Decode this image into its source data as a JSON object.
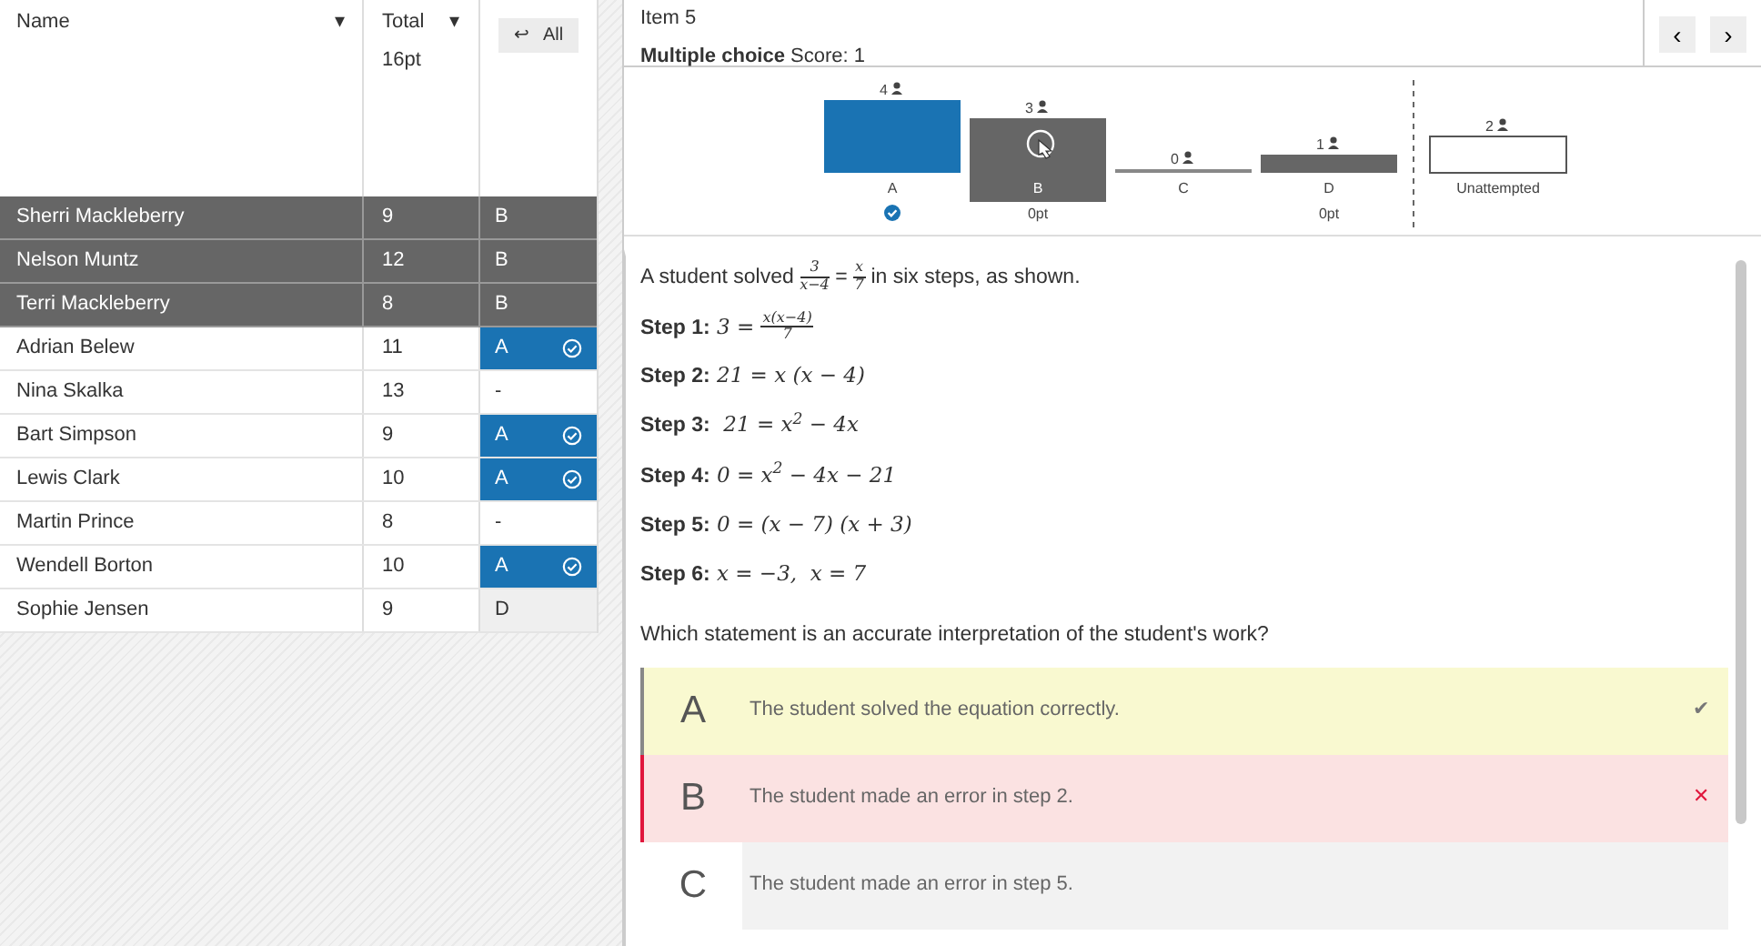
{
  "roster": {
    "columns": [
      {
        "label": "Name",
        "sort": "▾"
      },
      {
        "label": "Total",
        "sort": "▾",
        "sub": "16pt"
      }
    ],
    "back_button": {
      "arrow": "↩",
      "label": "All"
    },
    "rows": [
      {
        "name": "Sherri Mackleberry",
        "total": "9",
        "answer": "B",
        "highlighted": true,
        "correct": false
      },
      {
        "name": "Nelson Muntz",
        "total": "12",
        "answer": "B",
        "highlighted": true,
        "correct": false
      },
      {
        "name": "Terri Mackleberry",
        "total": "8",
        "answer": "B",
        "highlighted": true,
        "correct": false
      },
      {
        "name": "Adrian Belew",
        "total": "11",
        "answer": "A",
        "highlighted": false,
        "correct": true
      },
      {
        "name": "Nina Skalka",
        "total": "13",
        "answer": "-",
        "highlighted": false,
        "correct": false
      },
      {
        "name": "Bart Simpson",
        "total": "9",
        "answer": "A",
        "highlighted": false,
        "correct": true
      },
      {
        "name": "Lewis Clark",
        "total": "10",
        "answer": "A",
        "highlighted": false,
        "correct": true
      },
      {
        "name": "Martin Prince",
        "total": "8",
        "answer": "-",
        "highlighted": false,
        "correct": false
      },
      {
        "name": "Wendell Borton",
        "total": "10",
        "answer": "A",
        "highlighted": false,
        "correct": true
      },
      {
        "name": "Sophie Jensen",
        "total": "9",
        "answer": "D",
        "highlighted": false,
        "correct": false
      }
    ]
  },
  "item": {
    "title": "Item 5",
    "type": "Multiple choice",
    "score": "Score: 1",
    "nav": [
      "‹",
      "›"
    ]
  },
  "distribution": {
    "chart_data": {
      "type": "bar",
      "categories": [
        "A",
        "B",
        "C",
        "D",
        "Unattempted"
      ],
      "values": [
        4,
        3,
        0,
        1,
        2
      ],
      "data_labels": true
    },
    "bars": [
      {
        "kind": "correct",
        "selected": false
      },
      {
        "kind": "answer",
        "selected": true,
        "points": "0pt"
      },
      {
        "kind": "answer",
        "selected": false
      },
      {
        "kind": "answer",
        "selected": false,
        "points": "0pt"
      },
      {
        "kind": "unattempted",
        "selected": false
      }
    ]
  },
  "question": {
    "intro": [
      {
        "text": "A student solved "
      },
      {
        "num": "3",
        "den": "x−4"
      },
      {
        "text": " = "
      },
      {
        "num": "x",
        "den": "7"
      },
      {
        "text": " in six steps, as shown."
      }
    ],
    "steps": [
      {
        "label": "Step 1:",
        "math": [
          {
            "text": " 3 = "
          },
          {
            "num": "x(x−4)",
            "den": "7"
          }
        ]
      },
      {
        "label": "Step 2:",
        "math": [
          {
            "text": " 21 = x (x − 4)"
          }
        ]
      },
      {
        "label": "Step 3:",
        "math": [
          {
            "text": "  21 = x$^{2}$ − 4x"
          }
        ]
      },
      {
        "label": "Step 4:",
        "math": [
          {
            "text": " 0 = x$^{2}$ − 4x − 21"
          }
        ]
      },
      {
        "label": "Step 5:",
        "math": [
          {
            "text": " 0 = (x − 7) (x + 3)"
          }
        ]
      },
      {
        "label": "Step 6:",
        "math": [
          {
            "text": " x = −3,  x = 7"
          }
        ]
      }
    ],
    "prompt": "Which statement is an accurate interpretation of the student's work?",
    "choices": [
      {
        "letter": "A",
        "text": "The student solved the equation correctly.",
        "kind": "correct",
        "mark": "✔"
      },
      {
        "letter": "B",
        "text": "The student made an error in step 2.",
        "kind": "incorrect",
        "mark": "✕"
      },
      {
        "letter": "C",
        "text": "The student made an error in step 5.",
        "kind": "plain"
      }
    ]
  }
}
